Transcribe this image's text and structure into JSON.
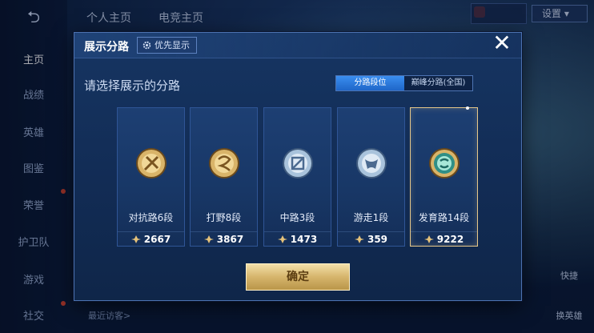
{
  "background": {
    "side_nav": [
      "主页",
      "战绩",
      "英雄",
      "图鉴",
      "荣誉",
      "护卫队",
      "游戏",
      "社交"
    ],
    "top_tabs": [
      "个人主页",
      "电竞主页"
    ],
    "settings_label": "设置",
    "corner_badge_text": "",
    "right_buttons": [
      "快捷",
      "换英雄"
    ],
    "recent_visitors_label": "最近访客>"
  },
  "modal": {
    "title": "展示分路",
    "priority_label": "优先显示",
    "subtitle": "请选择展示的分路",
    "segment": {
      "options": [
        "分路段位",
        "巅峰分路(全国)"
      ],
      "selected": "分路段位"
    },
    "cards": [
      {
        "lane": "对抗路6段",
        "score": "2667",
        "emblem": "clash-lane-emblem-icon",
        "selected": false
      },
      {
        "lane": "打野8段",
        "score": "3867",
        "emblem": "jungle-emblem-icon",
        "selected": false
      },
      {
        "lane": "中路3段",
        "score": "1473",
        "emblem": "mid-lane-emblem-icon",
        "selected": false
      },
      {
        "lane": "游走1段",
        "score": "359",
        "emblem": "roam-emblem-icon",
        "selected": false
      },
      {
        "lane": "发育路14段",
        "score": "9222",
        "emblem": "farm-lane-emblem-icon",
        "selected": true
      }
    ],
    "confirm_label": "确定",
    "close_symbol": "✕"
  },
  "colors": {
    "accent_blue": "#2a7be0",
    "gold": "#d6b56c",
    "selected_border": "#e7c88a",
    "panel": "#163562"
  }
}
